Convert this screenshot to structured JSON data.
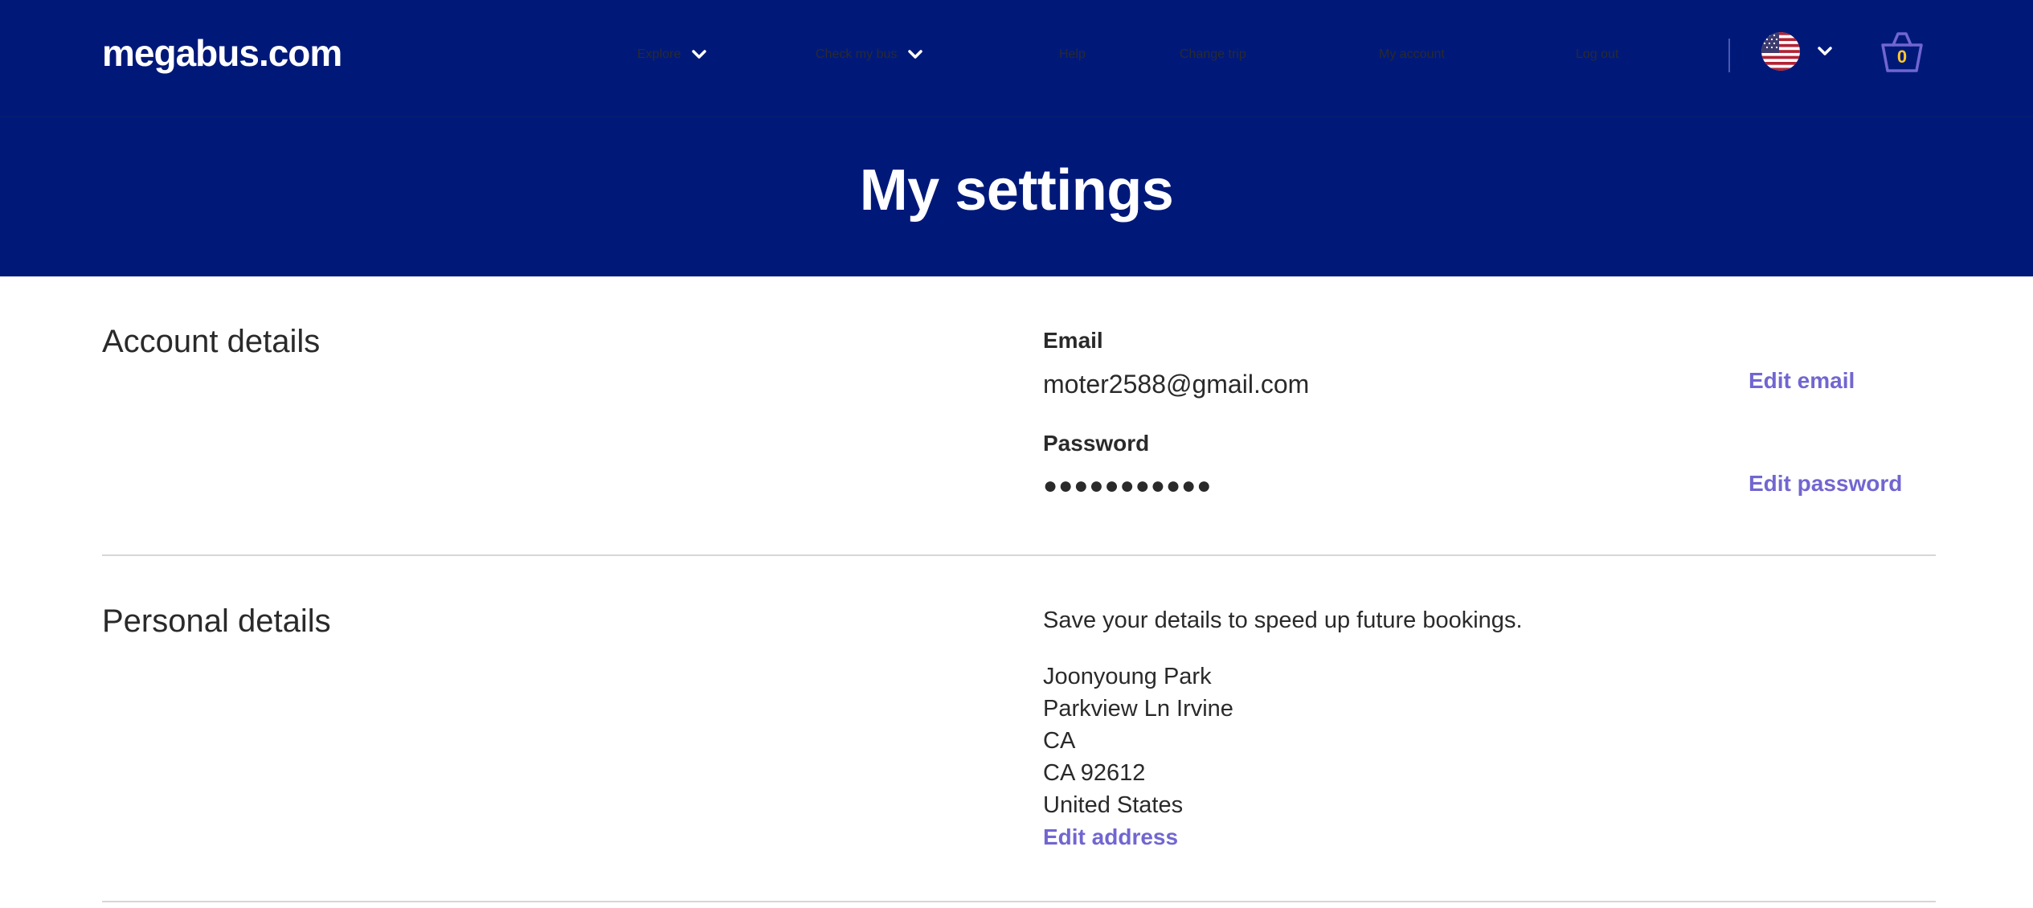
{
  "brand": {
    "logo_text": "megabus.com",
    "nav_bg": "#001979",
    "link_color": "#7166d1",
    "basket_count_color": "#ffc72c"
  },
  "nav": {
    "explore": "Explore",
    "check_my_bus": "Check my bus",
    "help": "Help",
    "change_trip": "Change trip",
    "my_account": "My account",
    "log_out": "Log out",
    "country_flag": "us-flag-icon",
    "basket_count": "0"
  },
  "page": {
    "title": "My settings"
  },
  "account_details": {
    "heading": "Account details",
    "email_label": "Email",
    "email_value": "moter2588@gmail.com",
    "edit_email": "Edit email",
    "password_label": "Password",
    "password_value": "●●●●●●●●●●●",
    "edit_password": "Edit password"
  },
  "personal_details": {
    "heading": "Personal details",
    "intro": "Save your details to speed up future bookings.",
    "address_lines": [
      "Joonyoung Park",
      "Parkview Ln Irvine",
      "CA",
      "CA 92612",
      "United States"
    ],
    "edit_address": "Edit address"
  }
}
